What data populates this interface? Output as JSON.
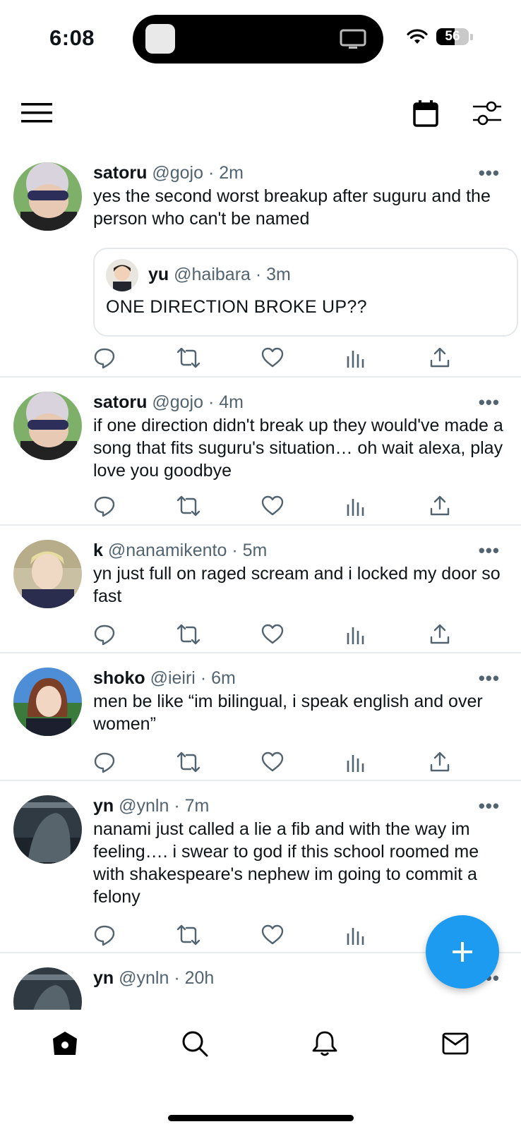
{
  "status_bar": {
    "time": "6:08",
    "battery": "56",
    "battery_level": 0.56
  },
  "tweets": [
    {
      "name": "satoru",
      "handle": "@gojo",
      "time": "· 2m",
      "text": "yes the second worst breakup after suguru and the person who can't be named",
      "quote": {
        "name": "yu",
        "handle": "@haibara",
        "time": "· 3m",
        "text": "ONE DIRECTION BROKE UP??"
      }
    },
    {
      "name": "satoru",
      "handle": "@gojo",
      "time": "· 4m",
      "text": "if one direction didn't break up they would've made a song that fits suguru's situation… oh wait alexa, play love you goodbye"
    },
    {
      "name": "k",
      "handle": "@nanamikento",
      "time": "· 5m",
      "text": "yn just full on raged scream and i locked my door so fast"
    },
    {
      "name": "shoko",
      "handle": "@ieiri",
      "time": "· 6m",
      "text": "men be like “im bilingual, i speak english and over women”"
    },
    {
      "name": "yn",
      "handle": "@ynln",
      "time": "· 7m",
      "text": "nanami just called a lie a fib and with the way im feeling…. i swear to god if this school roomed me with shakespeare's nephew im going to commit a felony"
    },
    {
      "name": "yn",
      "handle": "@ynln",
      "time": "· 20h",
      "text": ""
    }
  ],
  "icons": {
    "more": "more-options-icon",
    "reply": "reply-icon",
    "retweet": "retweet-icon",
    "like": "heart-icon",
    "stats": "stats-icon",
    "share": "share-icon"
  },
  "more_glyph": "•••",
  "colors": {
    "accent": "#1d9bf0",
    "secondary_text": "#536471"
  }
}
